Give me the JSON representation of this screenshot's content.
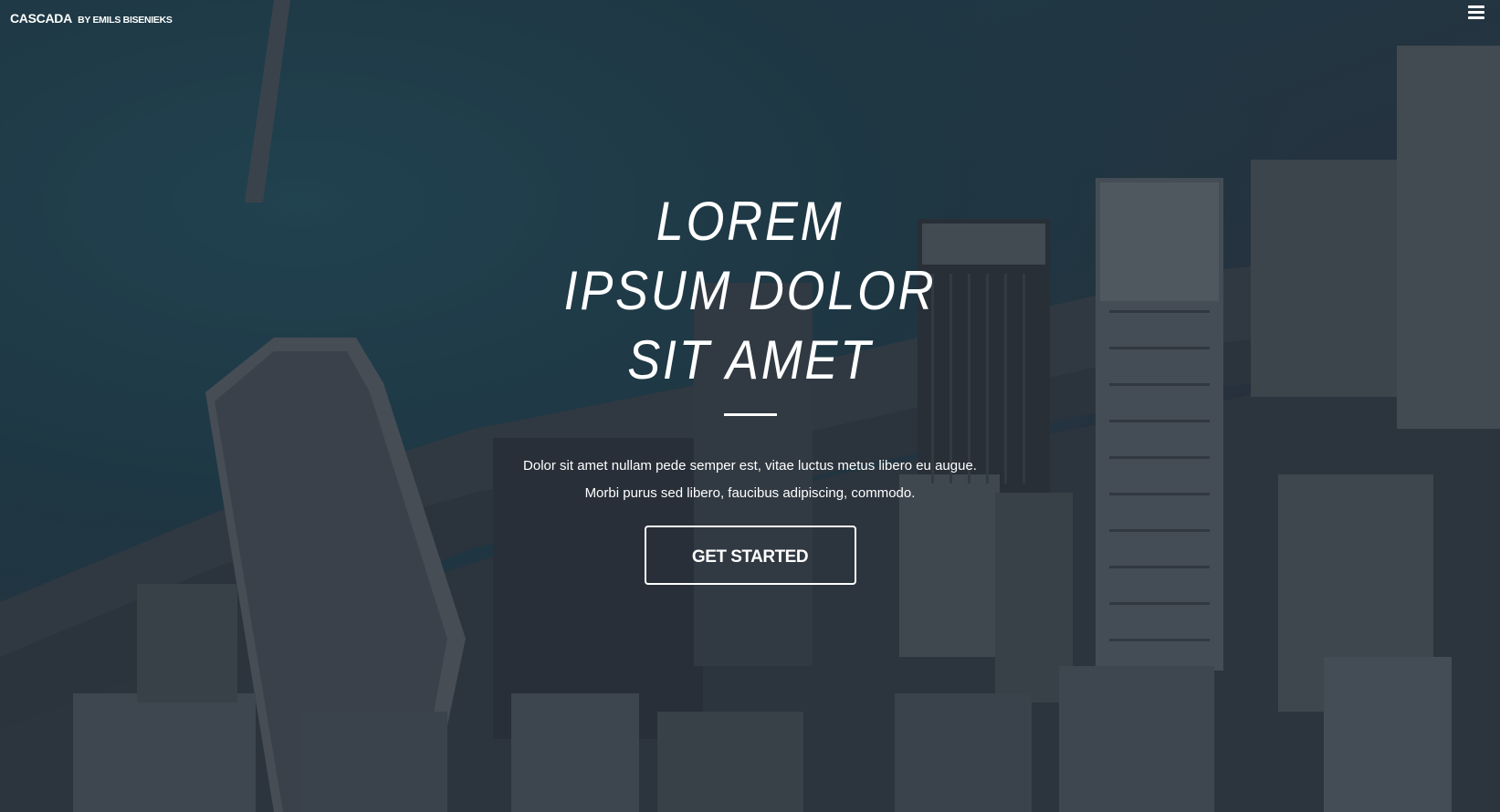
{
  "header": {
    "brand_name": "CASCADA",
    "brand_by": "BY EMILS BISENIEKS"
  },
  "hero": {
    "headline_lines": [
      "LOREM",
      "IPSUM DOLOR",
      "SIT AMET"
    ],
    "subtext_lines": [
      "Dolor sit amet nullam pede semper est, vitae luctus metus libero eu augue.",
      "Morbi purus sed libero, faucibus adipiscing, commodo."
    ],
    "cta_label": "GET STARTED"
  },
  "icons": {
    "menu": "hamburger-menu-icon"
  },
  "colors": {
    "text": "#ffffff",
    "water": "#1f4654",
    "buildings": "#3a4048"
  }
}
